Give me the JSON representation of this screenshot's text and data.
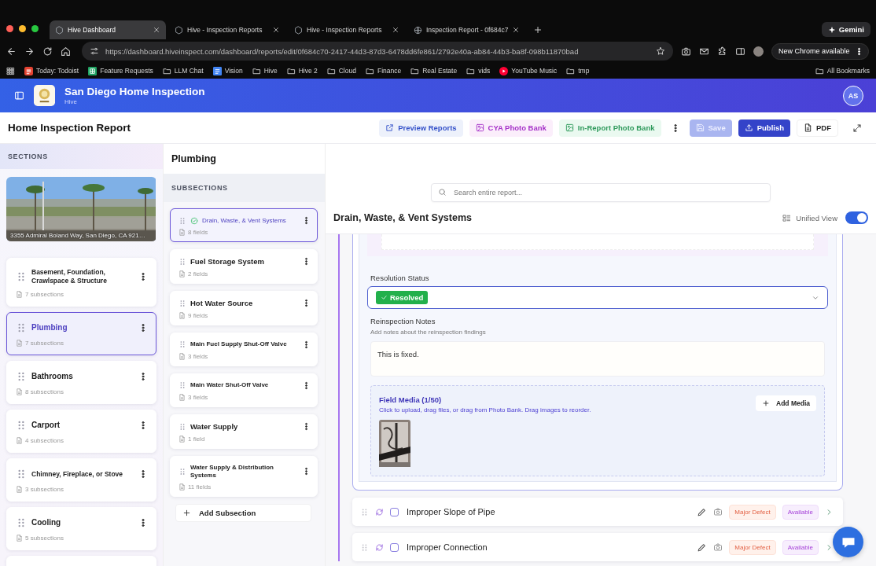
{
  "browser": {
    "tabs": [
      {
        "title": "Hive Dashboard",
        "kind": "hive",
        "selected": true
      },
      {
        "title": "Hive - Inspection Reports",
        "kind": "hive",
        "selected": false
      },
      {
        "title": "Hive - Inspection Reports",
        "kind": "hive",
        "selected": false
      },
      {
        "title": "Inspection Report - 0f684c7",
        "kind": "globe",
        "selected": false
      }
    ],
    "gemini": "Gemini",
    "url": "https://dashboard.hiveinspect.com/dashboard/reports/edit/0f684c70-2417-44d3-87d3-6478dd6fe861/2792e40a-ab84-44b3-ba8f-098b11870bad",
    "chrome_notice": "New Chrome available",
    "bookmarks": [
      {
        "label": "Today: Todoist",
        "kind": "app"
      },
      {
        "label": "Feature Requests",
        "kind": "sheet"
      },
      {
        "label": "LLM Chat",
        "kind": "folder"
      },
      {
        "label": "Vision",
        "kind": "doc"
      },
      {
        "label": "Hive",
        "kind": "folder"
      },
      {
        "label": "Hive 2",
        "kind": "folder"
      },
      {
        "label": "Cloud",
        "kind": "folder"
      },
      {
        "label": "Finance",
        "kind": "folder"
      },
      {
        "label": "Real Estate",
        "kind": "folder"
      },
      {
        "label": "vids",
        "kind": "folder"
      },
      {
        "label": "YouTube Music",
        "kind": "play"
      },
      {
        "label": "tmp",
        "kind": "folder"
      }
    ],
    "all_bookmarks": "All Bookmarks"
  },
  "app": {
    "org_name": "San Diego Home Inspection",
    "org_sub": "Hive",
    "avatar": "AS"
  },
  "toolbar": {
    "title": "Home Inspection Report",
    "buttons": [
      {
        "label": "Preview Reports",
        "kind": "preview",
        "disabled": false
      },
      {
        "label": "CYA Photo Bank",
        "kind": "cya",
        "disabled": false
      },
      {
        "label": "In-Report Photo Bank",
        "kind": "inreport",
        "disabled": false
      },
      {
        "kind": "more",
        "disabled": false
      },
      {
        "label": "Save",
        "kind": "save",
        "disabled": true
      },
      {
        "label": "Publish",
        "kind": "publish",
        "disabled": false
      },
      {
        "label": "PDF",
        "kind": "pdf",
        "disabled": false
      },
      {
        "kind": "expand",
        "disabled": false
      }
    ]
  },
  "sections": {
    "header": "SECTIONS",
    "photo_caption": "3355 Admiral Boland Way, San Diego, CA 921…",
    "items": [
      {
        "name": "Basement, Foundation, Crawlspace & Structure",
        "count": "7 subsections",
        "selected": false
      },
      {
        "name": "Plumbing",
        "count": "7 subsections",
        "selected": true
      },
      {
        "name": "Bathrooms",
        "count": "8 subsections",
        "selected": false
      },
      {
        "name": "Carport",
        "count": "4 subsections",
        "selected": false
      },
      {
        "name": "Chimney, Fireplace, or Stove",
        "count": "3 subsections",
        "selected": false
      },
      {
        "name": "Cooling",
        "count": "5 subsections",
        "selected": false
      }
    ]
  },
  "subsections": {
    "section_title": "Plumbing",
    "header": "SUBSECTIONS",
    "items": [
      {
        "name": "Drain, Waste, & Vent Systems",
        "count": "8 fields",
        "selected": true,
        "complete": true
      },
      {
        "name": "Fuel Storage System",
        "count": "2 fields",
        "selected": false,
        "complete": false
      },
      {
        "name": "Hot Water Source",
        "count": "9 fields",
        "selected": false,
        "complete": false
      },
      {
        "name": "Main Fuel Supply Shut-Off Valve",
        "count": "3 fields",
        "selected": false,
        "complete": false
      },
      {
        "name": "Main Water Shut-Off Valve",
        "count": "3 fields",
        "selected": false,
        "complete": false
      },
      {
        "name": "Water Supply",
        "count": "1 field",
        "selected": false,
        "complete": false
      },
      {
        "name": "Water Supply & Distribution Systems",
        "count": "11 fields",
        "selected": false,
        "complete": false
      }
    ],
    "add_label": "Add Subsection"
  },
  "main": {
    "search_placeholder": "Search entire report...",
    "title": "Drain, Waste, & Vent Systems",
    "unified_view": {
      "label": "Unified View",
      "on": true
    },
    "resolution": {
      "label": "Resolution Status",
      "value": "Resolved"
    },
    "notes": {
      "label": "Reinspection Notes",
      "hint": "Add notes about the reinspection findings",
      "value": "This is fixed."
    },
    "media": {
      "title": "Field Media (1/50)",
      "hint": "Click to upload, drag files, or drag from Photo Bank. Drag images to reorder.",
      "add_label": "Add Media"
    },
    "items": [
      {
        "title": "Improper Slope of Pipe",
        "severity": "Major Defect",
        "status": "Available",
        "checked": false
      },
      {
        "title": "Improper Connection",
        "severity": "Major Defect",
        "status": "Available",
        "checked": false
      }
    ]
  }
}
